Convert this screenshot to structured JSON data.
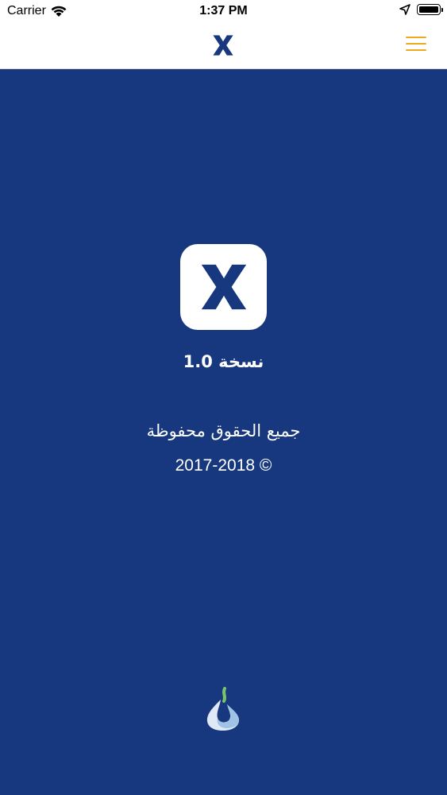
{
  "status_bar": {
    "carrier": "Carrier",
    "time": "1:37 PM",
    "icons": [
      "wifi-icon",
      "location-arrow-icon",
      "battery-icon"
    ]
  },
  "nav": {
    "logo_icon": "x-logo-icon",
    "menu_icon": "hamburger-menu-icon",
    "accent_color": "#f0a81e"
  },
  "about": {
    "app_icon": "x-logo-icon",
    "version_label": "نسخة 1.0",
    "rights_label": "جميع الحقوق محفوظة",
    "copyright_label": "2017-2018 ©"
  },
  "footer": {
    "brand_icon": "flame-drop-logo-icon"
  },
  "colors": {
    "background": "#17387f",
    "header_bg": "#ffffff",
    "logo": "#17387f",
    "text": "#ffffff"
  }
}
